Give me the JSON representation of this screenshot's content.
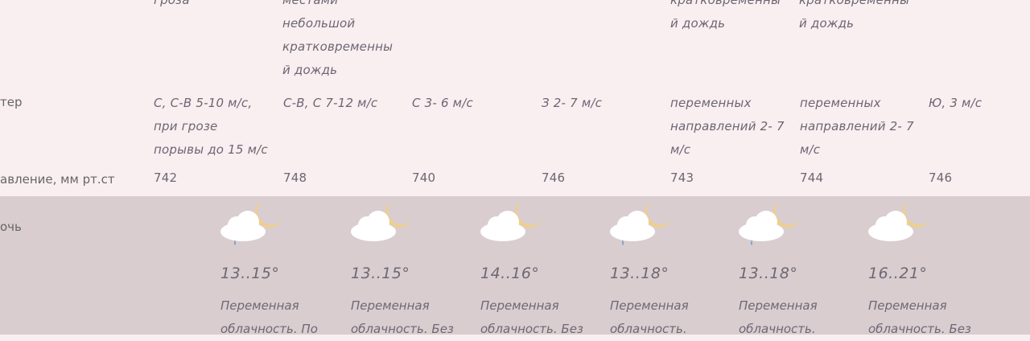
{
  "top_fragments": {
    "c1": "гроза",
    "c2": [
      "местами",
      "небольшой",
      "кратковременны",
      "й дождь"
    ],
    "c6": "й дождь",
    "c7": "й дождь",
    "c6_top": "кратковременны",
    "c7_top": "кратковременны"
  },
  "rows": {
    "wind": {
      "label": "тер",
      "values": [
        [
          "С, С-В 5-10 м/с,",
          "при грозе",
          "порывы до 15 м/с"
        ],
        [
          "С-В, С 7-12 м/с"
        ],
        [
          "С 3- 6 м/с"
        ],
        [
          "З 2- 7 м/с"
        ],
        [
          "переменных",
          "направлений 2- 7",
          "м/с"
        ],
        [
          "переменных",
          "направлений 2- 7",
          "м/с"
        ],
        [
          "Ю, 3 м/с"
        ]
      ]
    },
    "pressure": {
      "label": "авление, мм рт.ст",
      "values": [
        "742",
        "748",
        "740",
        "746",
        "743",
        "744",
        "746"
      ]
    }
  },
  "night": {
    "label": "очь",
    "days": [
      {
        "icon": "moon-cloud-rain-icon",
        "temp": "13..15°",
        "desc": [
          "Переменная",
          "облачность. По"
        ]
      },
      {
        "icon": "moon-cloud-icon",
        "temp": "13..15°",
        "desc": [
          "Переменная",
          "облачность. Без"
        ]
      },
      {
        "icon": "moon-cloud-icon",
        "temp": "14..16°",
        "desc": [
          "Переменная",
          "облачность. Без"
        ]
      },
      {
        "icon": "moon-cloud-rain-icon",
        "temp": "13..18°",
        "desc": [
          "Переменная",
          "облачность."
        ]
      },
      {
        "icon": "moon-cloud-rain-icon",
        "temp": "13..18°",
        "desc": [
          "Переменная",
          "облачность."
        ]
      },
      {
        "icon": "moon-cloud-icon",
        "temp": "16..21°",
        "desc": [
          "Переменная",
          "облачность. Без"
        ]
      }
    ]
  },
  "colors": {
    "background": "#f9eff1",
    "night_band": "#d9cdd0",
    "moon": "#f3cf7e",
    "cloud": "#ffffff"
  }
}
